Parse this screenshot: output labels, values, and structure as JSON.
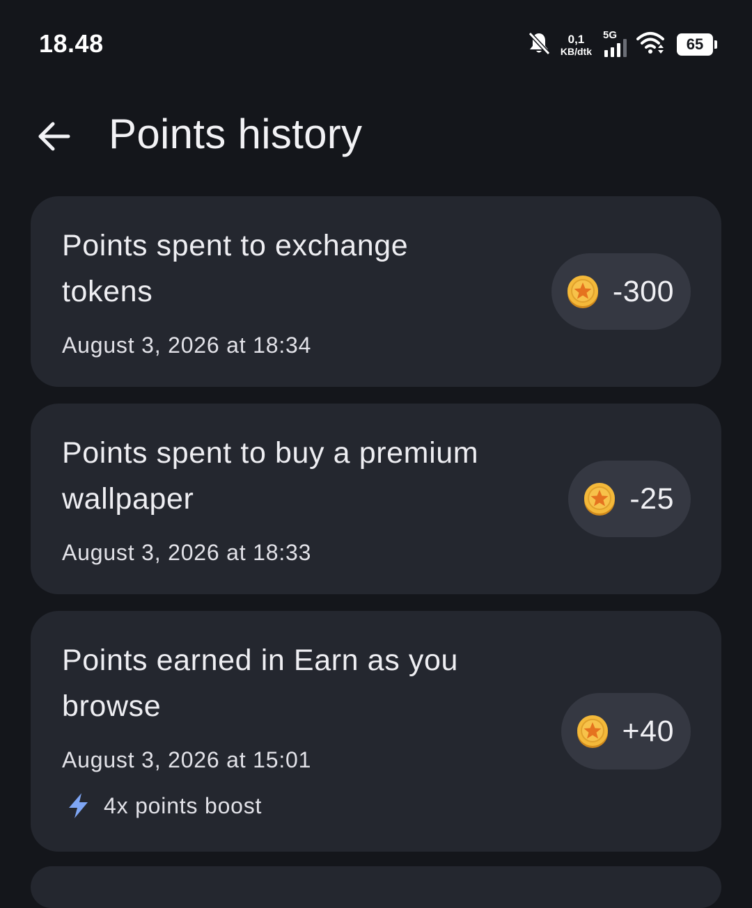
{
  "status_bar": {
    "time": "18.48",
    "net_speed_value": "0,1",
    "net_speed_unit": "KB/dtk",
    "network_type": "5G",
    "battery": "65"
  },
  "header": {
    "title": "Points history"
  },
  "history": [
    {
      "title_line1": "Points spent to exchange",
      "title_line2": "tokens",
      "date": "August 3, 2026 at 18:34",
      "amount": "-300"
    },
    {
      "title_line1": "Points spent to buy a premium",
      "title_line2": "wallpaper",
      "date": "August 3, 2026 at 18:33",
      "amount": "-25"
    },
    {
      "title_line1": "Points earned in Earn as you",
      "title_line2": "browse",
      "date": "August 3, 2026 at 15:01",
      "amount": "+40",
      "boost": "4x points boost"
    }
  ],
  "colors": {
    "background": "#14161b",
    "card": "#24272f",
    "chip": "#353842",
    "coin": "#f4b93a",
    "bolt": "#7ea6f5"
  },
  "icons": {
    "back": "arrow-left-icon",
    "coin": "star-coin-icon",
    "boost": "lightning-bolt-icon"
  }
}
